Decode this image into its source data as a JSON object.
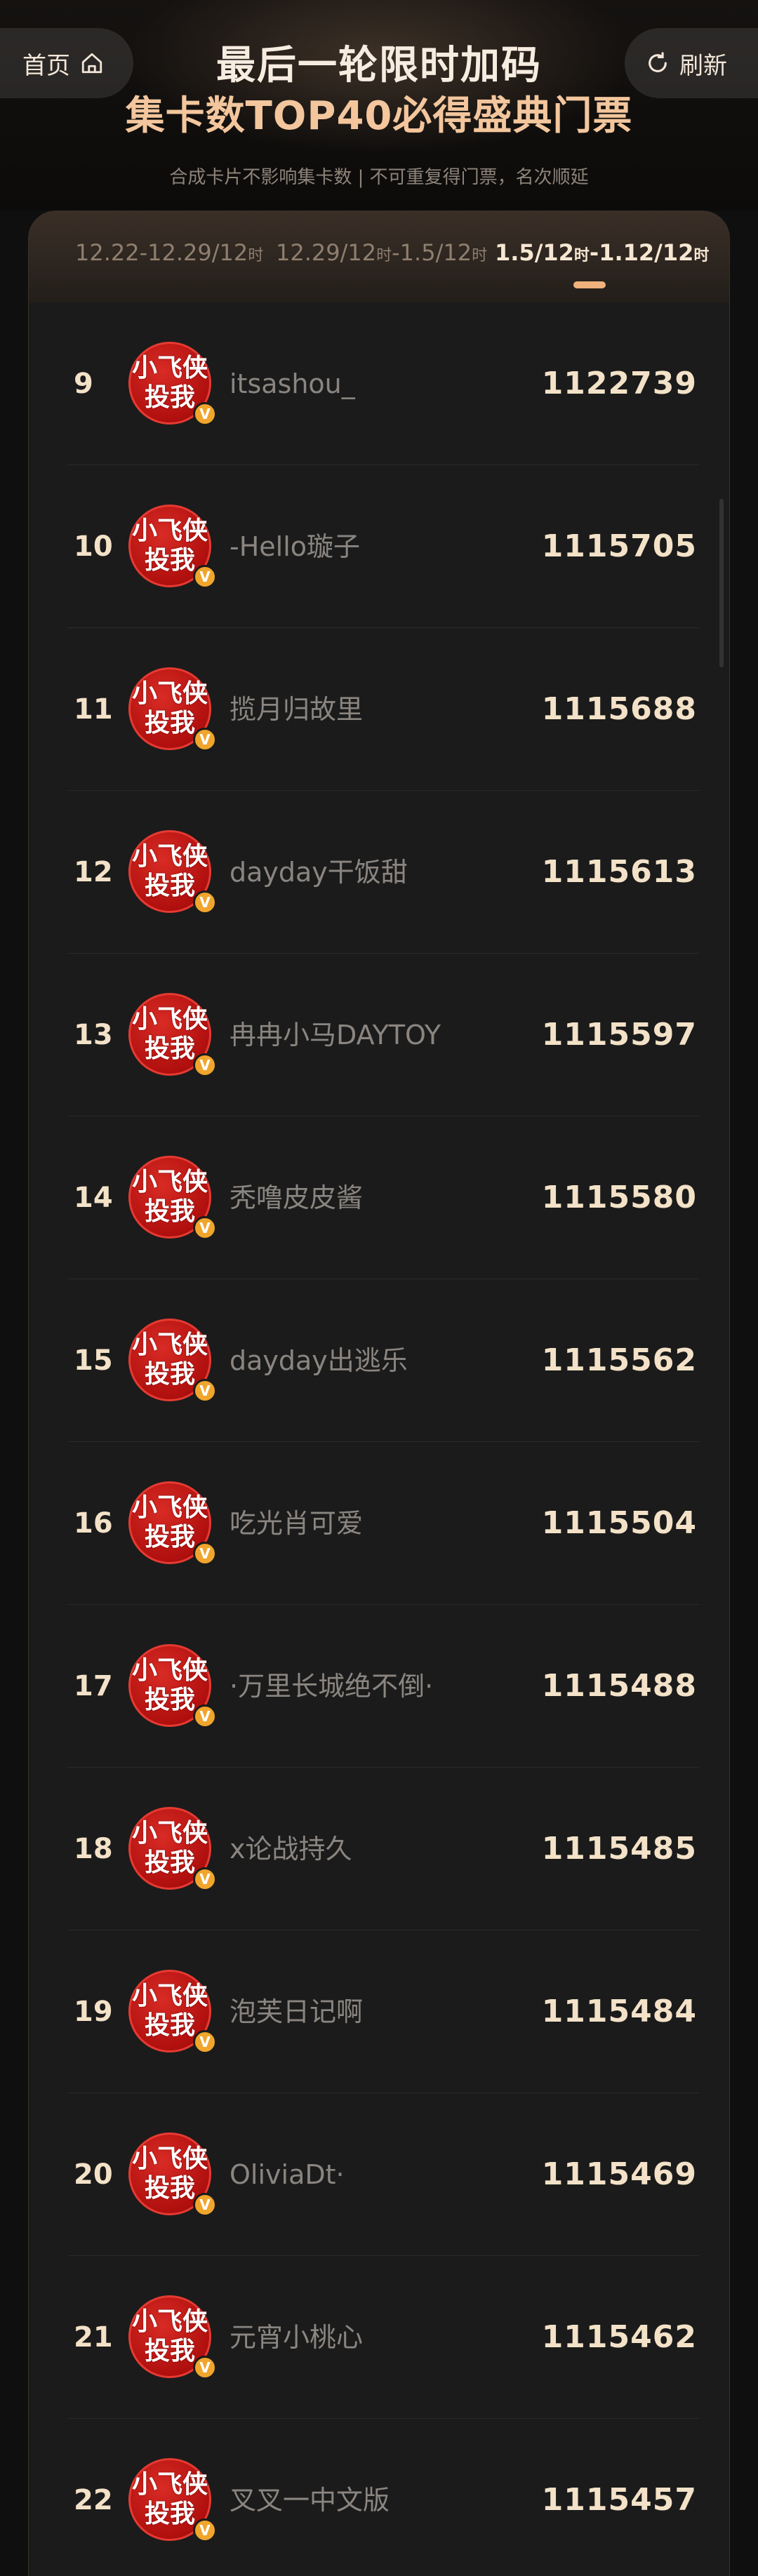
{
  "nav": {
    "home_label": "首页",
    "refresh_label": "刷新"
  },
  "header": {
    "title_line1": "最后一轮限时加码",
    "title_line2": "集卡数TOP40必得盛典门票",
    "subtitle": "合成卡片不影响集卡数 | 不可重复得门票，名次顺延"
  },
  "tabs": [
    {
      "label_a": "12.22-12.29/12",
      "small_a": "时",
      "label_b": "",
      "small_b": "",
      "active": false
    },
    {
      "label_a": "12.29/12",
      "small_a": "时",
      "label_b": "-1.5/12",
      "small_b": "时",
      "active": false
    },
    {
      "label_a": "1.5/12",
      "small_a": "时",
      "label_b": "-1.12/12",
      "small_b": "时",
      "active": true
    }
  ],
  "avatar_text": {
    "line1": "小飞侠",
    "line2": "投我",
    "badge": "V"
  },
  "ranking": [
    {
      "rank": "9",
      "name": "itsashou_",
      "score": "1122739"
    },
    {
      "rank": "10",
      "name": "-Hello璇子",
      "score": "1115705"
    },
    {
      "rank": "11",
      "name": "揽月归故里",
      "score": "1115688"
    },
    {
      "rank": "12",
      "name": "dayday干饭甜",
      "score": "1115613"
    },
    {
      "rank": "13",
      "name": "冉冉小马DAYTOY",
      "score": "1115597"
    },
    {
      "rank": "14",
      "name": "秃噜皮皮酱",
      "score": "1115580"
    },
    {
      "rank": "15",
      "name": "dayday出逃乐",
      "score": "1115562"
    },
    {
      "rank": "16",
      "name": "吃光肖可爱",
      "score": "1115504"
    },
    {
      "rank": "17",
      "name": "·万里长城绝不倒·",
      "score": "1115488"
    },
    {
      "rank": "18",
      "name": "x论战持久",
      "score": "1115485"
    },
    {
      "rank": "19",
      "name": "泡芙日记啊",
      "score": "1115484"
    },
    {
      "rank": "20",
      "name": "OliviaDt·",
      "score": "1115469"
    },
    {
      "rank": "21",
      "name": "元宵小桃心",
      "score": "1115462"
    },
    {
      "rank": "22",
      "name": "叉叉一中文版",
      "score": "1115457"
    }
  ],
  "colors": {
    "accent": "#f1b27c",
    "title_gold": "#f3c69d",
    "avatar_red": "#c0120f",
    "badge_orange": "#f0a52c"
  }
}
